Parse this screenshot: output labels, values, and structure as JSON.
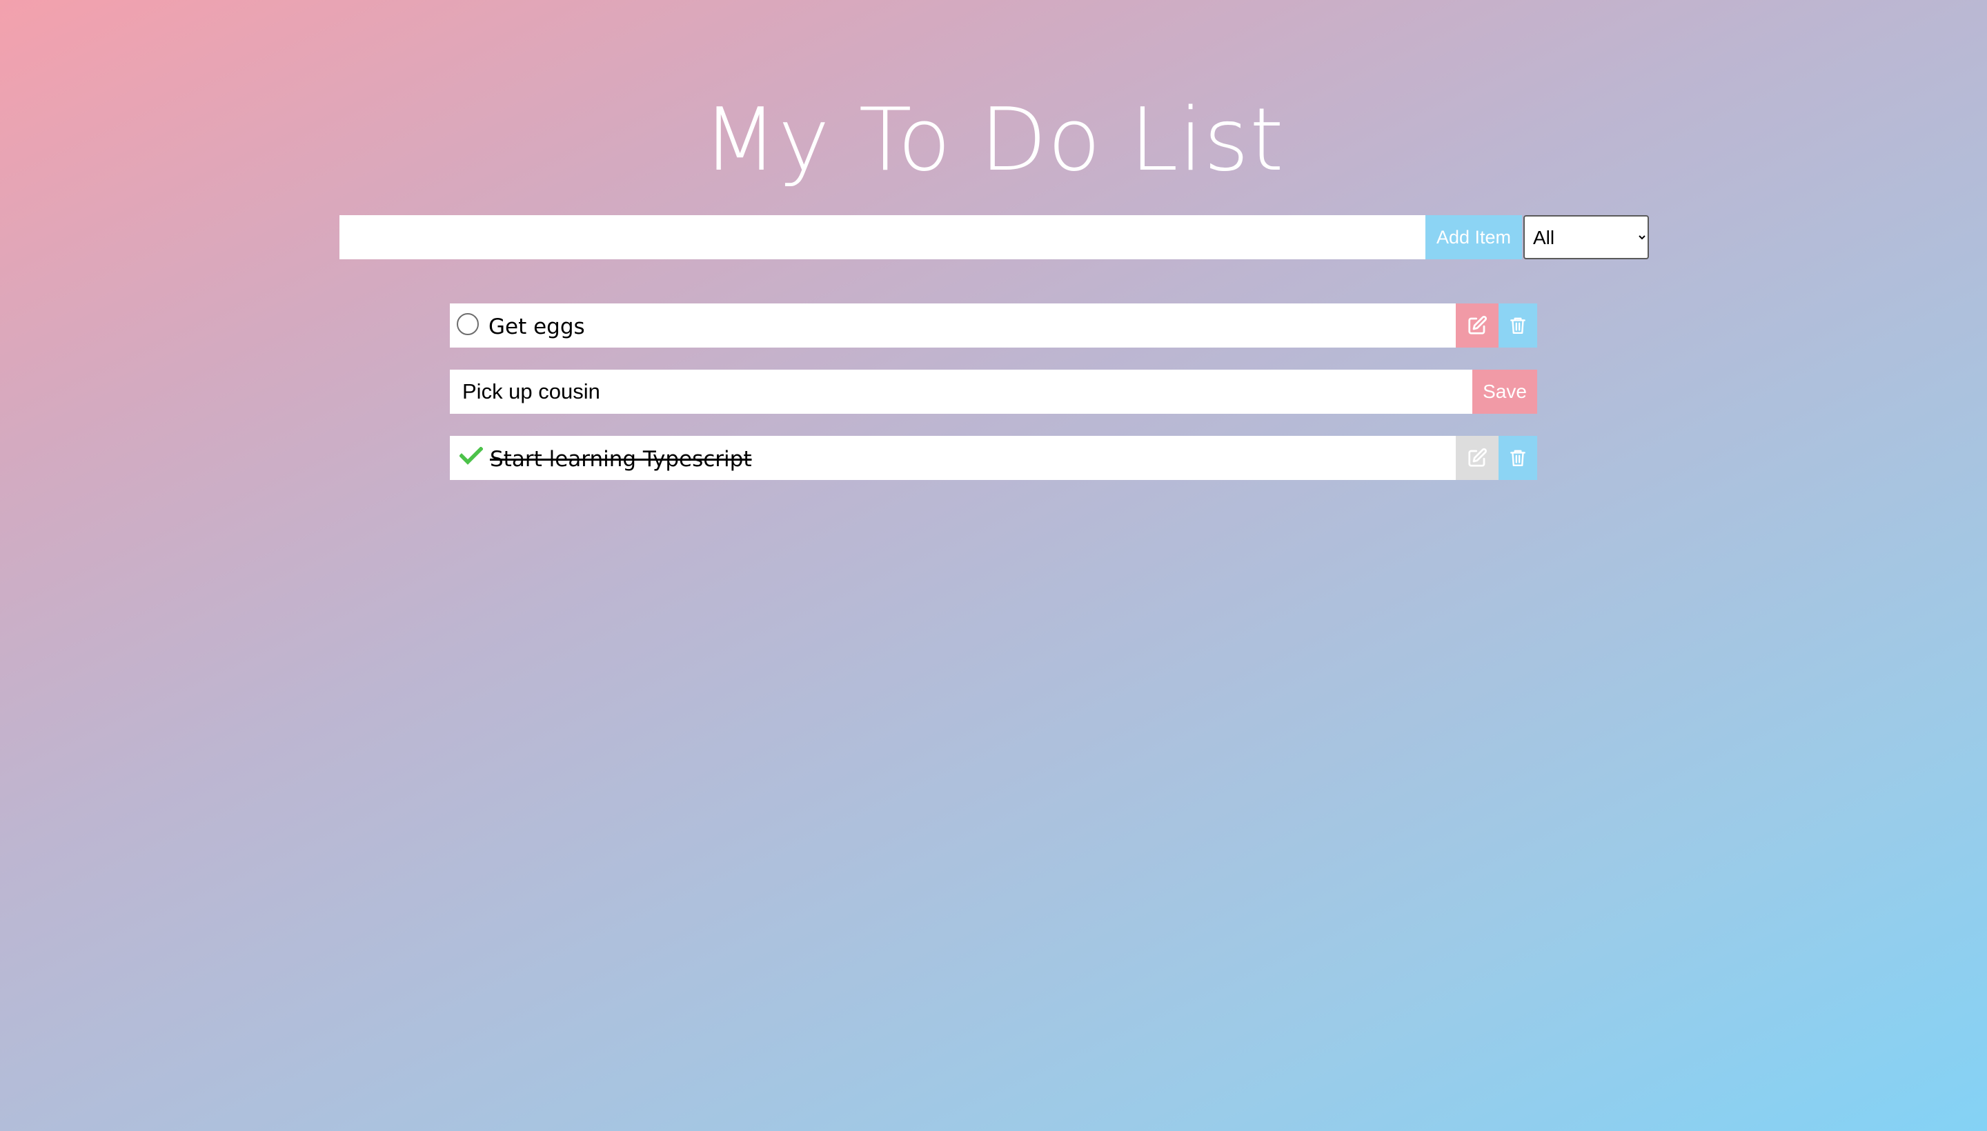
{
  "header": {
    "title": "My To Do List"
  },
  "add_form": {
    "input_value": "",
    "add_button_label": "Add Item",
    "filter": {
      "selected": "All",
      "options": [
        "All"
      ]
    }
  },
  "todos": [
    {
      "text": "Get eggs",
      "completed": false,
      "editing": false,
      "icons": {
        "status": "circle-unchecked-icon",
        "edit": "edit-icon",
        "delete": "trash-icon"
      }
    },
    {
      "edit_value": "Pick up cousin",
      "editing": true,
      "save_label": "Save"
    },
    {
      "text": "Start learning Typescript",
      "completed": true,
      "editing": false,
      "icons": {
        "status": "checkmark-icon",
        "edit": "edit-icon",
        "delete": "trash-icon"
      }
    }
  ],
  "colors": {
    "gradient_start": "#f3a1ad",
    "gradient_end": "#84d2f5",
    "accent_blue": "#8cd4f4",
    "accent_pink": "#f19aa6",
    "disabled_gray": "#dddddd",
    "check_green": "#4cc24a"
  }
}
